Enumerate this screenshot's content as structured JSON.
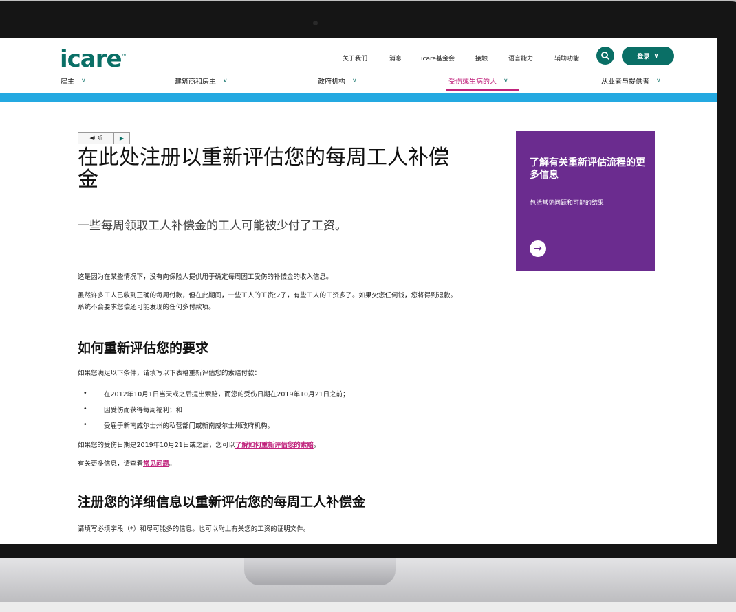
{
  "header": {
    "logo": "icare",
    "logo_tm": "™",
    "utility_links": [
      "关于我们",
      "消息",
      "icare基金会",
      "接触",
      "语言能力",
      "辅助功能"
    ],
    "login_label": "登录",
    "main_nav": [
      {
        "label": "雇主"
      },
      {
        "label": "建筑商和房主"
      },
      {
        "label": "政府机构"
      },
      {
        "label": "受伤或生病的人"
      },
      {
        "label": "从业者与提供者"
      }
    ]
  },
  "audio": {
    "listen_label": "听"
  },
  "article": {
    "title": "在此处注册以重新评估您的每周工人补偿金",
    "subtitle": "一些每周领取工人补偿金的工人可能被少付了工资。",
    "para1": "这是因为在某些情况下，没有向保险人提供用于确定每周因工受伤的补偿金的收入信息。",
    "para2": "虽然许多工人已收到正确的每周付款，但在此期间，一些工人的工资少了，有些工人的工资多了。如果欠您任何钱，您将得到退款。系统不会要求您偿还可能发现的任何多付款项。",
    "h2_1": "如何重新评估您的要求",
    "conditions_intro": "如果您满足以下条件，请填写以下表格重新评估您的索赔付款：",
    "conditions": [
      "在2012年10月1日当天或之后提出索赔，而您的受伤日期在2019年10月21日之前；",
      "因受伤而获得每周福利；和",
      "受雇于新南威尔士州的私营部门或新南威尔士州政府机构。"
    ],
    "after_text": "如果您的受伤日期是2019年10月21日或之后，您可以",
    "after_link": "了解如何重新评估您的索赔",
    "after_end": "。",
    "faq_text": "有关更多信息，请查看",
    "faq_link": "常见问题",
    "faq_end": "。",
    "h2_2": "注册您的详细信息以重新评估您的每周工人补偿金",
    "form_intro": "请填写必填字段（*）和尽可能多的信息。也可以附上有关您的工资的证明文件。"
  },
  "card": {
    "title": "了解有关重新评估流程的更多信息",
    "description": "包括常见问题和可能的结果",
    "color": "#6b2c8f"
  },
  "colors": {
    "brand": "#0a6f66",
    "accent": "#c0237c",
    "band": "#24a9e1"
  }
}
